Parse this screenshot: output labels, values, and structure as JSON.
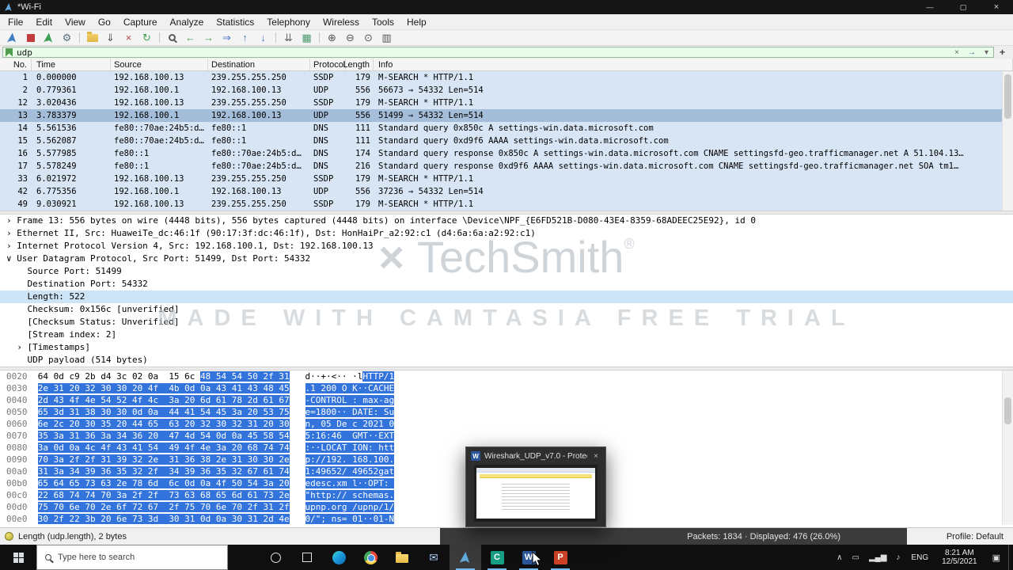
{
  "window": {
    "title": "*Wi-Fi",
    "minimize": "—",
    "maximize": "▢",
    "close": "×"
  },
  "menu": {
    "items": [
      "File",
      "Edit",
      "View",
      "Go",
      "Capture",
      "Analyze",
      "Statistics",
      "Telephony",
      "Wireless",
      "Tools",
      "Help"
    ]
  },
  "toolbar": {
    "items": [
      {
        "name": "start-capture-icon",
        "kind": "fin",
        "color": "#3f7fc1"
      },
      {
        "name": "stop-capture-icon",
        "kind": "sq",
        "color": "#c33c3c"
      },
      {
        "name": "restart-capture-icon",
        "kind": "fin",
        "color": "#3da054"
      },
      {
        "name": "capture-options-icon",
        "kind": "glyph",
        "glyph": "⚙",
        "color": "#56707f"
      },
      {
        "kind": "sep"
      },
      {
        "name": "open-file-icon",
        "kind": "folder"
      },
      {
        "name": "save-file-icon",
        "kind": "glyph",
        "glyph": "⇓",
        "color": "#555555"
      },
      {
        "name": "close-file-icon",
        "kind": "glyph",
        "glyph": "×",
        "color": "#b04a4a"
      },
      {
        "name": "reload-icon",
        "kind": "glyph",
        "glyph": "↻",
        "color": "#3da054"
      },
      {
        "kind": "sep"
      },
      {
        "name": "find-packet-icon",
        "kind": "mag"
      },
      {
        "name": "go-back-icon",
        "kind": "glyph",
        "glyph": "←",
        "color": "#3da054"
      },
      {
        "name": "go-forward-icon",
        "kind": "glyph",
        "glyph": "→",
        "color": "#3da054"
      },
      {
        "name": "go-to-packet-icon",
        "kind": "glyph",
        "glyph": "⇒",
        "color": "#4a7fc1"
      },
      {
        "name": "first-packet-icon",
        "kind": "glyph",
        "glyph": "↑",
        "color": "#4a7fc1"
      },
      {
        "name": "last-packet-icon",
        "kind": "glyph",
        "glyph": "↓",
        "color": "#4a7fc1"
      },
      {
        "kind": "sep"
      },
      {
        "name": "auto-scroll-icon",
        "kind": "glyph",
        "glyph": "⇊",
        "color": "#666666"
      },
      {
        "name": "colorize-icon",
        "kind": "glyph",
        "glyph": "▦",
        "color": "#4a9a6a"
      },
      {
        "kind": "sep"
      },
      {
        "name": "zoom-in-icon",
        "kind": "glyph",
        "glyph": "⊕",
        "color": "#555555"
      },
      {
        "name": "zoom-out-icon",
        "kind": "glyph",
        "glyph": "⊖",
        "color": "#555555"
      },
      {
        "name": "zoom-reset-icon",
        "kind": "glyph",
        "glyph": "⊙",
        "color": "#555555"
      },
      {
        "name": "resize-columns-icon",
        "kind": "glyph",
        "glyph": "▥",
        "color": "#555555"
      }
    ]
  },
  "filter": {
    "value": "udp",
    "clear": "×",
    "apply": "→",
    "dropdown": "▾",
    "add": "+"
  },
  "packet_list": {
    "columns": [
      "No.",
      "Time",
      "Source",
      "Destination",
      "Protocol",
      "Length",
      "Info"
    ],
    "rows": [
      {
        "no": "1",
        "time": "0.000000",
        "src": "192.168.100.13",
        "dst": "239.255.255.250",
        "proto": "SSDP",
        "len": "179",
        "info": "M-SEARCH * HTTP/1.1",
        "selected": false
      },
      {
        "no": "2",
        "time": "0.779361",
        "src": "192.168.100.1",
        "dst": "192.168.100.13",
        "proto": "UDP",
        "len": "556",
        "info": "56673 → 54332 Len=514",
        "selected": false
      },
      {
        "no": "12",
        "time": "3.020436",
        "src": "192.168.100.13",
        "dst": "239.255.255.250",
        "proto": "SSDP",
        "len": "179",
        "info": "M-SEARCH * HTTP/1.1",
        "selected": false
      },
      {
        "no": "13",
        "time": "3.783379",
        "src": "192.168.100.1",
        "dst": "192.168.100.13",
        "proto": "UDP",
        "len": "556",
        "info": "51499 → 54332 Len=514",
        "selected": true
      },
      {
        "no": "14",
        "time": "5.561536",
        "src": "fe80::70ae:24b5:d…",
        "dst": "fe80::1",
        "proto": "DNS",
        "len": "111",
        "info": "Standard query 0x850c A settings-win.data.microsoft.com",
        "selected": false
      },
      {
        "no": "15",
        "time": "5.562087",
        "src": "fe80::70ae:24b5:d…",
        "dst": "fe80::1",
        "proto": "DNS",
        "len": "111",
        "info": "Standard query 0xd9f6 AAAA settings-win.data.microsoft.com",
        "selected": false
      },
      {
        "no": "16",
        "time": "5.577985",
        "src": "fe80::1",
        "dst": "fe80::70ae:24b5:d…",
        "proto": "DNS",
        "len": "174",
        "info": "Standard query response 0x850c A settings-win.data.microsoft.com CNAME settingsfd-geo.trafficmanager.net A 51.104.13…",
        "selected": false
      },
      {
        "no": "17",
        "time": "5.578249",
        "src": "fe80::1",
        "dst": "fe80::70ae:24b5:d…",
        "proto": "DNS",
        "len": "216",
        "info": "Standard query response 0xd9f6 AAAA settings-win.data.microsoft.com CNAME settingsfd-geo.trafficmanager.net SOA tm1…",
        "selected": false
      },
      {
        "no": "33",
        "time": "6.021972",
        "src": "192.168.100.13",
        "dst": "239.255.255.250",
        "proto": "SSDP",
        "len": "179",
        "info": "M-SEARCH * HTTP/1.1",
        "selected": false
      },
      {
        "no": "42",
        "time": "6.775356",
        "src": "192.168.100.1",
        "dst": "192.168.100.13",
        "proto": "UDP",
        "len": "556",
        "info": "37236 → 54332 Len=514",
        "selected": false
      },
      {
        "no": "49",
        "time": "9.030921",
        "src": "192.168.100.13",
        "dst": "239.255.255.250",
        "proto": "SSDP",
        "len": "179",
        "info": "M-SEARCH * HTTP/1.1",
        "selected": false
      }
    ]
  },
  "details": {
    "lines": [
      {
        "chev": "›",
        "indent": 0,
        "text": "Frame 13: 556 bytes on wire (4448 bits), 556 bytes captured (4448 bits) on interface \\Device\\NPF_{E6FD521B-D080-43E4-8359-68ADEEC25E92}, id 0",
        "selected": false
      },
      {
        "chev": "›",
        "indent": 0,
        "text": "Ethernet II, Src: HuaweiTe_dc:46:1f (90:17:3f:dc:46:1f), Dst: HonHaiPr_a2:92:c1 (d4:6a:6a:a2:92:c1)",
        "selected": false
      },
      {
        "chev": "›",
        "indent": 0,
        "text": "Internet Protocol Version 4, Src: 192.168.100.1, Dst: 192.168.100.13",
        "selected": false
      },
      {
        "chev": "∨",
        "indent": 0,
        "text": "User Datagram Protocol, Src Port: 51499, Dst Port: 54332",
        "selected": false
      },
      {
        "indent": 1,
        "text": "Source Port: 51499",
        "selected": false
      },
      {
        "indent": 1,
        "text": "Destination Port: 54332",
        "selected": false
      },
      {
        "indent": 1,
        "text": "Length: 522",
        "selected": true
      },
      {
        "indent": 1,
        "text": "Checksum: 0x156c [unverified]",
        "selected": false
      },
      {
        "indent": 1,
        "text": "[Checksum Status: Unverified]",
        "selected": false
      },
      {
        "indent": 1,
        "text": "[Stream index: 2]",
        "selected": false
      },
      {
        "chev": "›",
        "indent": 1,
        "text": "[Timestamps]",
        "selected": false
      },
      {
        "indent": 1,
        "text": "UDP payload (514 bytes)",
        "selected": false
      }
    ]
  },
  "hex": {
    "rows": [
      {
        "offset": "0020",
        "hex_plain": "64 0d c9 2b d4 3c 02 0a  15 6c ",
        "hex_sel": "48 54 54 50 2f 31",
        "ascii_plain": "d··+·<·· ·l",
        "ascii_sel": "HTTP/1"
      },
      {
        "offset": "0030",
        "hex_plain": "",
        "hex_sel": "2e 31 20 32 30 30 20 4f  4b 0d 0a 43 41 43 48 45",
        "ascii_plain": "",
        "ascii_sel": ".1 200 O K··CACHE"
      },
      {
        "offset": "0040",
        "hex_plain": "",
        "hex_sel": "2d 43 4f 4e 54 52 4f 4c  3a 20 6d 61 78 2d 61 67",
        "ascii_plain": "",
        "ascii_sel": "-CONTROL : max-ag"
      },
      {
        "offset": "0050",
        "hex_plain": "",
        "hex_sel": "65 3d 31 38 30 30 0d 0a  44 41 54 45 3a 20 53 75",
        "ascii_plain": "",
        "ascii_sel": "e=1800·· DATE: Su"
      },
      {
        "offset": "0060",
        "hex_plain": "",
        "hex_sel": "6e 2c 20 30 35 20 44 65  63 20 32 30 32 31 20 30",
        "ascii_plain": "",
        "ascii_sel": "n, 05 De c 2021 0"
      },
      {
        "offset": "0070",
        "hex_plain": "",
        "hex_sel": "35 3a 31 36 3a 34 36 20  47 4d 54 0d 0a 45 58 54",
        "ascii_plain": "",
        "ascii_sel": "5:16:46  GMT··EXT"
      },
      {
        "offset": "0080",
        "hex_plain": "",
        "hex_sel": "3a 0d 0a 4c 4f 43 41 54  49 4f 4e 3a 20 68 74 74",
        "ascii_plain": "",
        "ascii_sel": ":··LOCAT ION: htt"
      },
      {
        "offset": "0090",
        "hex_plain": "",
        "hex_sel": "70 3a 2f 2f 31 39 32 2e  31 36 38 2e 31 30 30 2e",
        "ascii_plain": "",
        "ascii_sel": "p://192. 168.100."
      },
      {
        "offset": "00a0",
        "hex_plain": "",
        "hex_sel": "31 3a 34 39 36 35 32 2f  34 39 36 35 32 67 61 74",
        "ascii_plain": "",
        "ascii_sel": "1:49652/ 49652gat"
      },
      {
        "offset": "00b0",
        "hex_plain": "",
        "hex_sel": "65 64 65 73 63 2e 78 6d  6c 0d 0a 4f 50 54 3a 20",
        "ascii_plain": "",
        "ascii_sel": "edesc.xm l··OPT: "
      },
      {
        "offset": "00c0",
        "hex_plain": "",
        "hex_sel": "22 68 74 74 70 3a 2f 2f  73 63 68 65 6d 61 73 2e",
        "ascii_plain": "",
        "ascii_sel": "\"http:// schemas."
      },
      {
        "offset": "00d0",
        "hex_plain": "",
        "hex_sel": "75 70 6e 70 2e 6f 72 67  2f 75 70 6e 70 2f 31 2f",
        "ascii_plain": "",
        "ascii_sel": "upnp.org /upnp/1/"
      },
      {
        "offset": "00e0",
        "hex_plain": "",
        "hex_sel": "30 2f 22 3b 20 6e 73 3d  30 31 0d 0a 30 31 2d 4e",
        "ascii_plain": "",
        "ascii_sel": "0/\"; ns= 01··01-N"
      }
    ]
  },
  "status": {
    "left": "Length (udp.length), 2 bytes",
    "packets": "Packets: 1834 · Displayed: 476 (26.0%)",
    "profile": "Profile: Default"
  },
  "watermark": {
    "mark": "×",
    "brand": "TechSmith",
    "reg": "®",
    "tagline": "MADE WITH CAMTASIA FREE TRIAL"
  },
  "preview": {
    "title": "Wireshark_UDP_v7.0 - Protecte...",
    "close": "×"
  },
  "taskbar": {
    "search_placeholder": "Type here to search",
    "apps": [
      {
        "name": "cortana",
        "kind": "circle"
      },
      {
        "name": "task-view",
        "kind": "tv"
      },
      {
        "name": "edge",
        "kind": "edge"
      },
      {
        "name": "chrome",
        "kind": "chrome"
      },
      {
        "name": "file-explorer",
        "kind": "folder"
      },
      {
        "name": "mail",
        "kind": "glyph",
        "glyph": "✉",
        "color": "#a5c9ef"
      },
      {
        "name": "wireshark",
        "kind": "fin",
        "color": "#63a9dd",
        "active": true
      },
      {
        "name": "camtasia",
        "kind": "letter",
        "letter": "C",
        "color": "#169f85",
        "underline": true
      },
      {
        "name": "word",
        "kind": "letter",
        "letter": "W",
        "color": "#2b579a",
        "underline": true
      },
      {
        "name": "powerpoint",
        "kind": "letter",
        "letter": "P",
        "color": "#cc4125",
        "underline": true
      }
    ],
    "tray": {
      "icons": [
        {
          "name": "hidden-icons-chevron",
          "glyph": "∧"
        },
        {
          "name": "battery-icon",
          "glyph": "▭"
        },
        {
          "name": "network-icon",
          "glyph": "▂▄▆"
        },
        {
          "name": "volume-icon",
          "glyph": "♪"
        }
      ],
      "lang": "ENG",
      "time": "8:21 AM",
      "date": "12/5/2021",
      "action_center": "▣"
    }
  }
}
